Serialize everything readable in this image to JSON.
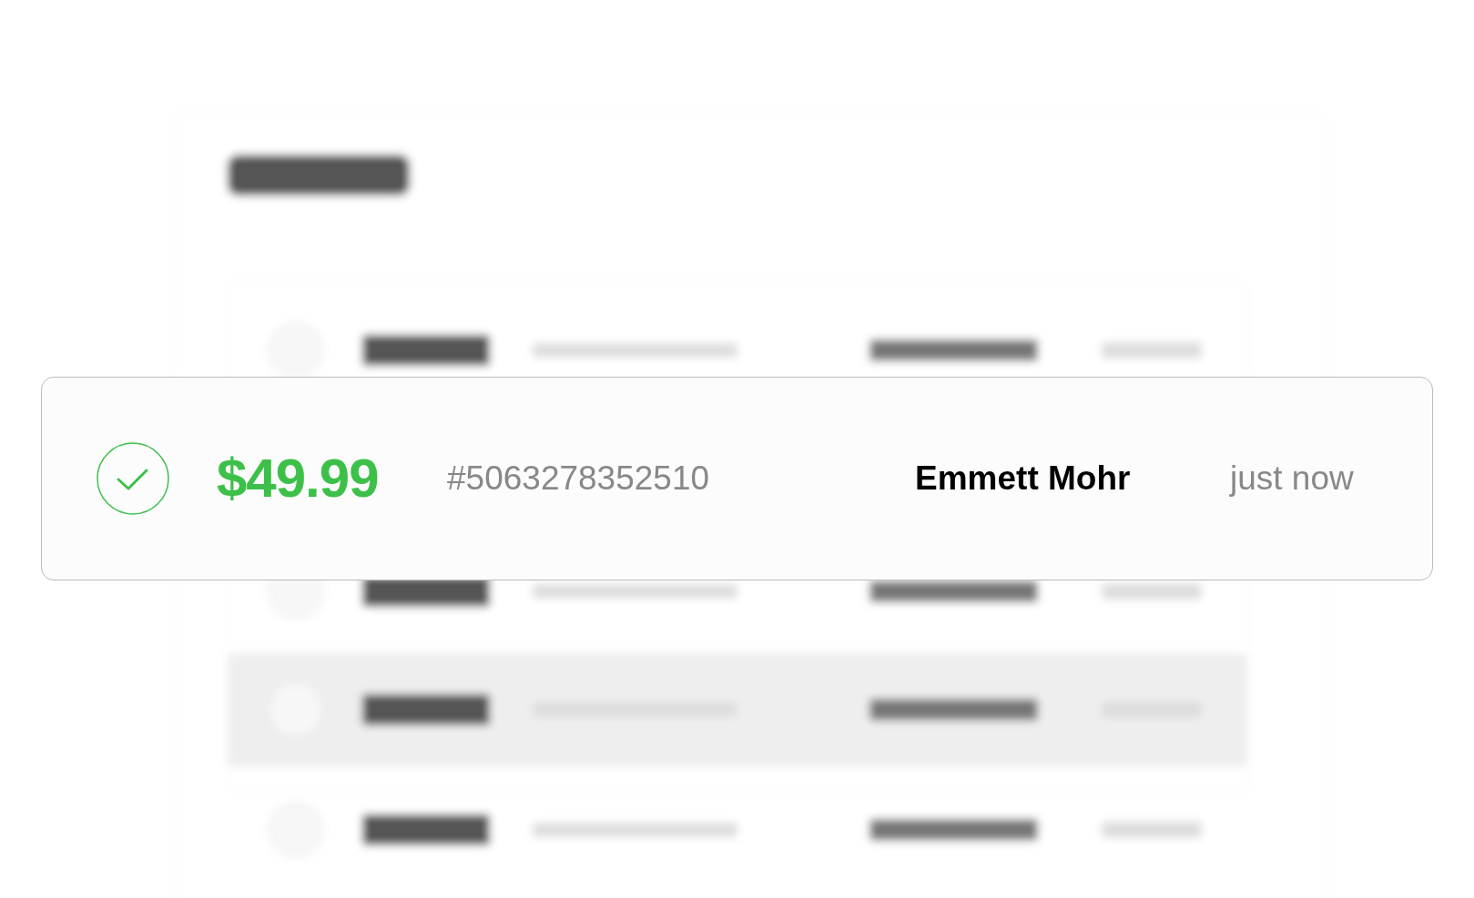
{
  "focused_order": {
    "amount": "$49.99",
    "order_number": "#5063278352510",
    "customer": "Emmett Mohr",
    "time": "just now"
  }
}
